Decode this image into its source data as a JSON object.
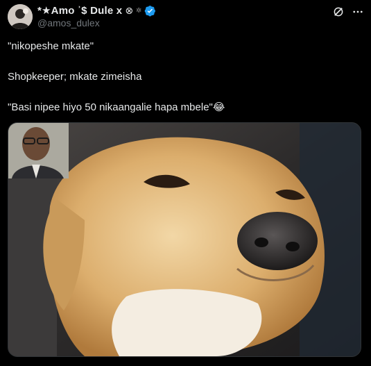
{
  "author": {
    "display_name": "*★Amo ʾ$ Dule x",
    "handle": "@amos_dulex",
    "avatar_icon": "profile-photo",
    "verified_icon": "verified-badge-icon"
  },
  "actions": {
    "grok_icon": "grok-icon",
    "more_icon": "more-options-icon"
  },
  "tweet": {
    "line1": "\"nikopeshe mkate\"",
    "line2": "Shopkeeper; mkate zimeisha",
    "line3": "\"Basi nipee hiyo 50 nikaangalie hapa mbele\"😂"
  },
  "media": {
    "description_icon": "meme-image-dog-smug",
    "inset_icon": "man-glasses-inset"
  },
  "colors": {
    "background": "#000000",
    "text": "#e7e9ea",
    "muted": "#71767b",
    "verified": "#1d9bf0"
  }
}
